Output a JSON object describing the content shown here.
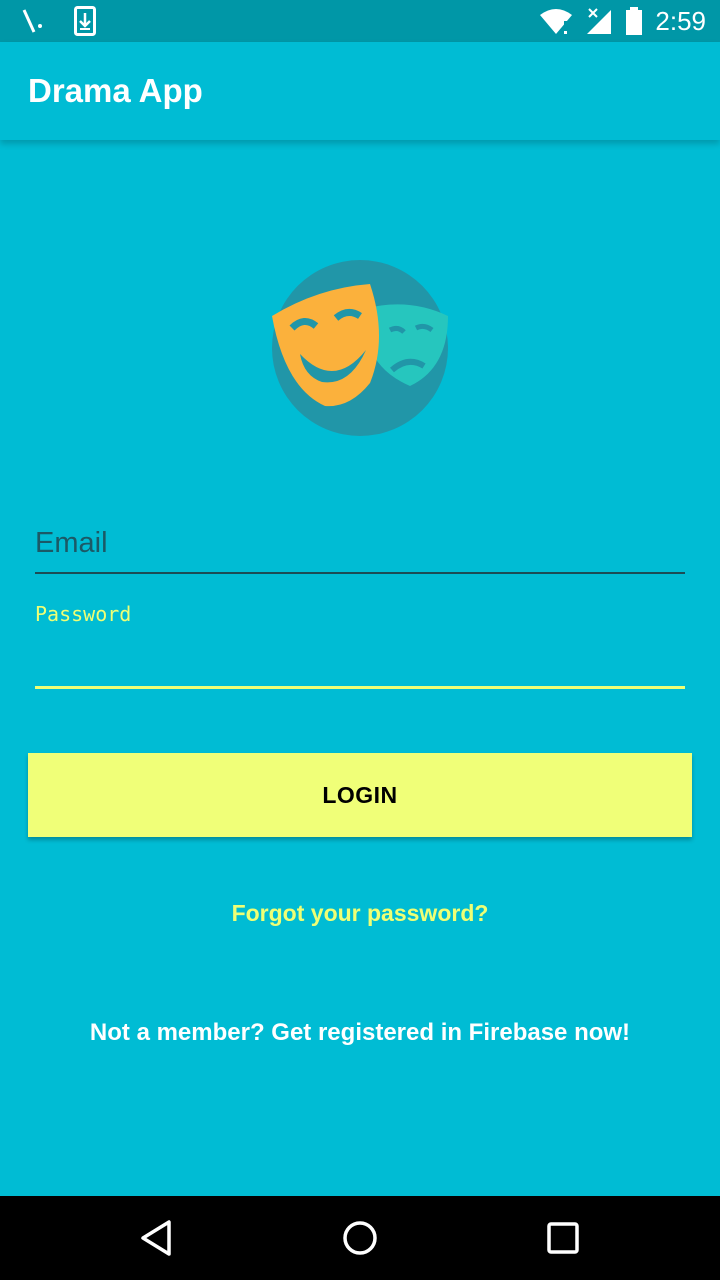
{
  "status_bar": {
    "time": "2:59",
    "icons": [
      "signal-slash-icon",
      "download-icon",
      "wifi-icon",
      "cell-signal-icon",
      "battery-icon"
    ]
  },
  "app_bar": {
    "title": "Drama App"
  },
  "logo": {
    "icon": "drama-masks-icon"
  },
  "form": {
    "email_placeholder": "Email",
    "email_value": "",
    "password_label": "Password",
    "password_value": "",
    "login_label": "LOGIN"
  },
  "links": {
    "forgot_password": "Forgot your password?",
    "register": "Not a member? Get registered in Firebase now!"
  },
  "nav_bar": {
    "icons": [
      "back-icon",
      "home-icon",
      "recents-icon"
    ]
  },
  "colors": {
    "primary": "#00BCD4",
    "primary_dark": "#0097A7",
    "accent": "#EEFF75",
    "button": "#F0FF78"
  }
}
